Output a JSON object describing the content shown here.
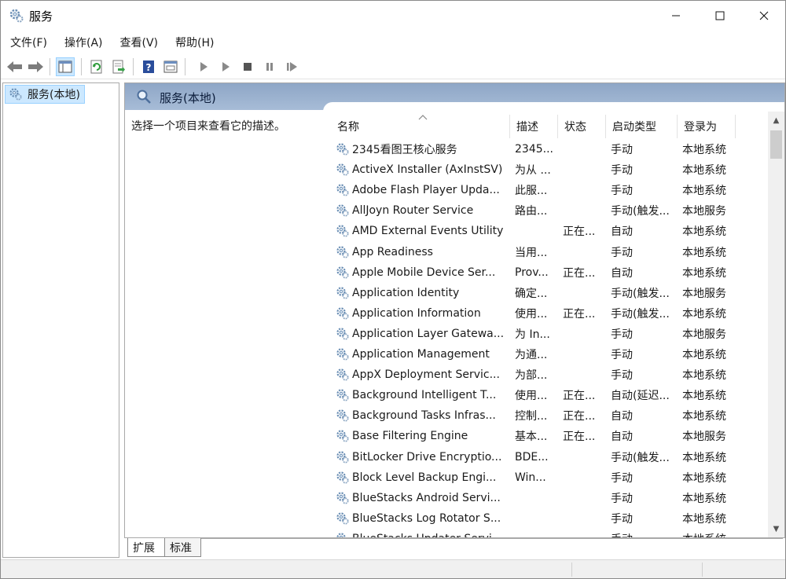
{
  "window": {
    "title": "服务",
    "icon": "gear-icon",
    "controls": [
      "minimize-icon",
      "maximize-icon",
      "close-icon"
    ]
  },
  "menu": [
    {
      "label": "文件(F)"
    },
    {
      "label": "操作(A)"
    },
    {
      "label": "查看(V)"
    },
    {
      "label": "帮助(H)"
    }
  ],
  "toolbar": {
    "buttons": [
      "back-icon",
      "forward-icon",
      "show-hide-console-tree-icon",
      "refresh-icon",
      "export-list-icon",
      "help-icon",
      "properties-icon",
      "start-service-icon",
      "start-service-alt-icon",
      "stop-service-icon",
      "pause-service-icon",
      "restart-service-icon"
    ]
  },
  "tree": {
    "item_label": "服务(本地)"
  },
  "pane": {
    "header_title": "服务(本地)",
    "description_prompt": "选择一个项目来查看它的描述。"
  },
  "table": {
    "columns": {
      "name": "名称",
      "description": "描述",
      "status": "状态",
      "startup_type": "启动类型",
      "log_on_as": "登录为"
    },
    "rows": [
      {
        "name": "2345看图王核心服务",
        "description": "2345...",
        "status": "",
        "startup_type": "手动",
        "log_on_as": "本地系统"
      },
      {
        "name": "ActiveX Installer (AxInstSV)",
        "description": "为从 ...",
        "status": "",
        "startup_type": "手动",
        "log_on_as": "本地系统"
      },
      {
        "name": "Adobe Flash Player Upda...",
        "description": "此服...",
        "status": "",
        "startup_type": "手动",
        "log_on_as": "本地系统"
      },
      {
        "name": "AllJoyn Router Service",
        "description": "路由...",
        "status": "",
        "startup_type": "手动(触发...",
        "log_on_as": "本地服务"
      },
      {
        "name": "AMD External Events Utility",
        "description": "",
        "status": "正在...",
        "startup_type": "自动",
        "log_on_as": "本地系统"
      },
      {
        "name": "App Readiness",
        "description": "当用...",
        "status": "",
        "startup_type": "手动",
        "log_on_as": "本地系统"
      },
      {
        "name": "Apple Mobile Device Ser...",
        "description": "Prov...",
        "status": "正在...",
        "startup_type": "自动",
        "log_on_as": "本地系统"
      },
      {
        "name": "Application Identity",
        "description": "确定...",
        "status": "",
        "startup_type": "手动(触发...",
        "log_on_as": "本地服务"
      },
      {
        "name": "Application Information",
        "description": "使用...",
        "status": "正在...",
        "startup_type": "手动(触发...",
        "log_on_as": "本地系统"
      },
      {
        "name": "Application Layer Gatewa...",
        "description": "为 In...",
        "status": "",
        "startup_type": "手动",
        "log_on_as": "本地服务"
      },
      {
        "name": "Application Management",
        "description": "为通...",
        "status": "",
        "startup_type": "手动",
        "log_on_as": "本地系统"
      },
      {
        "name": "AppX Deployment Servic...",
        "description": "为部...",
        "status": "",
        "startup_type": "手动",
        "log_on_as": "本地系统"
      },
      {
        "name": "Background Intelligent T...",
        "description": "使用...",
        "status": "正在...",
        "startup_type": "自动(延迟...",
        "log_on_as": "本地系统"
      },
      {
        "name": "Background Tasks Infras...",
        "description": "控制...",
        "status": "正在...",
        "startup_type": "自动",
        "log_on_as": "本地系统"
      },
      {
        "name": "Base Filtering Engine",
        "description": "基本...",
        "status": "正在...",
        "startup_type": "自动",
        "log_on_as": "本地服务"
      },
      {
        "name": "BitLocker Drive Encryptio...",
        "description": "BDE...",
        "status": "",
        "startup_type": "手动(触发...",
        "log_on_as": "本地系统"
      },
      {
        "name": "Block Level Backup Engi...",
        "description": "Win...",
        "status": "",
        "startup_type": "手动",
        "log_on_as": "本地系统"
      },
      {
        "name": "BlueStacks Android Servi...",
        "description": "",
        "status": "",
        "startup_type": "手动",
        "log_on_as": "本地系统"
      },
      {
        "name": "BlueStacks Log Rotator S...",
        "description": "",
        "status": "",
        "startup_type": "手动",
        "log_on_as": "本地系统"
      },
      {
        "name": "BlueStacks Updater Servi...",
        "description": "",
        "status": "",
        "startup_type": "手动",
        "log_on_as": "本地系统"
      }
    ]
  },
  "tabs": {
    "extended": "扩展",
    "standard": "标准"
  },
  "colors": {
    "header_gradient_top": "#8ea6c6",
    "header_gradient_bottom": "#a7bcd7",
    "selection": "#cce8ff"
  }
}
